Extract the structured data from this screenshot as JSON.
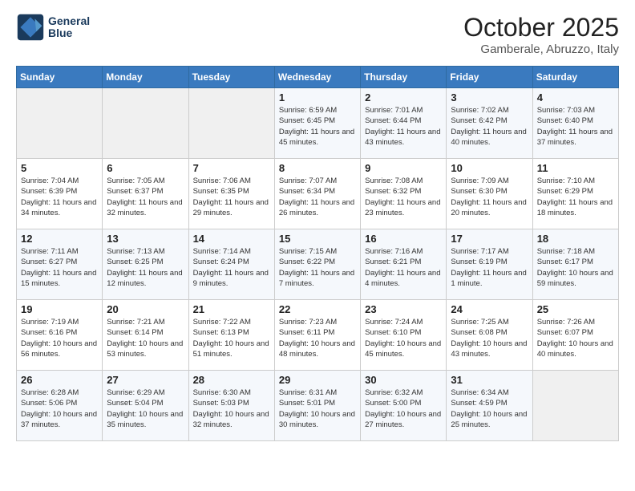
{
  "logo": {
    "line1": "General",
    "line2": "Blue"
  },
  "title": "October 2025",
  "location": "Gamberale, Abruzzo, Italy",
  "days_of_week": [
    "Sunday",
    "Monday",
    "Tuesday",
    "Wednesday",
    "Thursday",
    "Friday",
    "Saturday"
  ],
  "weeks": [
    [
      {
        "day": "",
        "info": ""
      },
      {
        "day": "",
        "info": ""
      },
      {
        "day": "",
        "info": ""
      },
      {
        "day": "1",
        "info": "Sunrise: 6:59 AM\nSunset: 6:45 PM\nDaylight: 11 hours and 45 minutes."
      },
      {
        "day": "2",
        "info": "Sunrise: 7:01 AM\nSunset: 6:44 PM\nDaylight: 11 hours and 43 minutes."
      },
      {
        "day": "3",
        "info": "Sunrise: 7:02 AM\nSunset: 6:42 PM\nDaylight: 11 hours and 40 minutes."
      },
      {
        "day": "4",
        "info": "Sunrise: 7:03 AM\nSunset: 6:40 PM\nDaylight: 11 hours and 37 minutes."
      }
    ],
    [
      {
        "day": "5",
        "info": "Sunrise: 7:04 AM\nSunset: 6:39 PM\nDaylight: 11 hours and 34 minutes."
      },
      {
        "day": "6",
        "info": "Sunrise: 7:05 AM\nSunset: 6:37 PM\nDaylight: 11 hours and 32 minutes."
      },
      {
        "day": "7",
        "info": "Sunrise: 7:06 AM\nSunset: 6:35 PM\nDaylight: 11 hours and 29 minutes."
      },
      {
        "day": "8",
        "info": "Sunrise: 7:07 AM\nSunset: 6:34 PM\nDaylight: 11 hours and 26 minutes."
      },
      {
        "day": "9",
        "info": "Sunrise: 7:08 AM\nSunset: 6:32 PM\nDaylight: 11 hours and 23 minutes."
      },
      {
        "day": "10",
        "info": "Sunrise: 7:09 AM\nSunset: 6:30 PM\nDaylight: 11 hours and 20 minutes."
      },
      {
        "day": "11",
        "info": "Sunrise: 7:10 AM\nSunset: 6:29 PM\nDaylight: 11 hours and 18 minutes."
      }
    ],
    [
      {
        "day": "12",
        "info": "Sunrise: 7:11 AM\nSunset: 6:27 PM\nDaylight: 11 hours and 15 minutes."
      },
      {
        "day": "13",
        "info": "Sunrise: 7:13 AM\nSunset: 6:25 PM\nDaylight: 11 hours and 12 minutes."
      },
      {
        "day": "14",
        "info": "Sunrise: 7:14 AM\nSunset: 6:24 PM\nDaylight: 11 hours and 9 minutes."
      },
      {
        "day": "15",
        "info": "Sunrise: 7:15 AM\nSunset: 6:22 PM\nDaylight: 11 hours and 7 minutes."
      },
      {
        "day": "16",
        "info": "Sunrise: 7:16 AM\nSunset: 6:21 PM\nDaylight: 11 hours and 4 minutes."
      },
      {
        "day": "17",
        "info": "Sunrise: 7:17 AM\nSunset: 6:19 PM\nDaylight: 11 hours and 1 minute."
      },
      {
        "day": "18",
        "info": "Sunrise: 7:18 AM\nSunset: 6:17 PM\nDaylight: 10 hours and 59 minutes."
      }
    ],
    [
      {
        "day": "19",
        "info": "Sunrise: 7:19 AM\nSunset: 6:16 PM\nDaylight: 10 hours and 56 minutes."
      },
      {
        "day": "20",
        "info": "Sunrise: 7:21 AM\nSunset: 6:14 PM\nDaylight: 10 hours and 53 minutes."
      },
      {
        "day": "21",
        "info": "Sunrise: 7:22 AM\nSunset: 6:13 PM\nDaylight: 10 hours and 51 minutes."
      },
      {
        "day": "22",
        "info": "Sunrise: 7:23 AM\nSunset: 6:11 PM\nDaylight: 10 hours and 48 minutes."
      },
      {
        "day": "23",
        "info": "Sunrise: 7:24 AM\nSunset: 6:10 PM\nDaylight: 10 hours and 45 minutes."
      },
      {
        "day": "24",
        "info": "Sunrise: 7:25 AM\nSunset: 6:08 PM\nDaylight: 10 hours and 43 minutes."
      },
      {
        "day": "25",
        "info": "Sunrise: 7:26 AM\nSunset: 6:07 PM\nDaylight: 10 hours and 40 minutes."
      }
    ],
    [
      {
        "day": "26",
        "info": "Sunrise: 6:28 AM\nSunset: 5:06 PM\nDaylight: 10 hours and 37 minutes."
      },
      {
        "day": "27",
        "info": "Sunrise: 6:29 AM\nSunset: 5:04 PM\nDaylight: 10 hours and 35 minutes."
      },
      {
        "day": "28",
        "info": "Sunrise: 6:30 AM\nSunset: 5:03 PM\nDaylight: 10 hours and 32 minutes."
      },
      {
        "day": "29",
        "info": "Sunrise: 6:31 AM\nSunset: 5:01 PM\nDaylight: 10 hours and 30 minutes."
      },
      {
        "day": "30",
        "info": "Sunrise: 6:32 AM\nSunset: 5:00 PM\nDaylight: 10 hours and 27 minutes."
      },
      {
        "day": "31",
        "info": "Sunrise: 6:34 AM\nSunset: 4:59 PM\nDaylight: 10 hours and 25 minutes."
      },
      {
        "day": "",
        "info": ""
      }
    ]
  ]
}
